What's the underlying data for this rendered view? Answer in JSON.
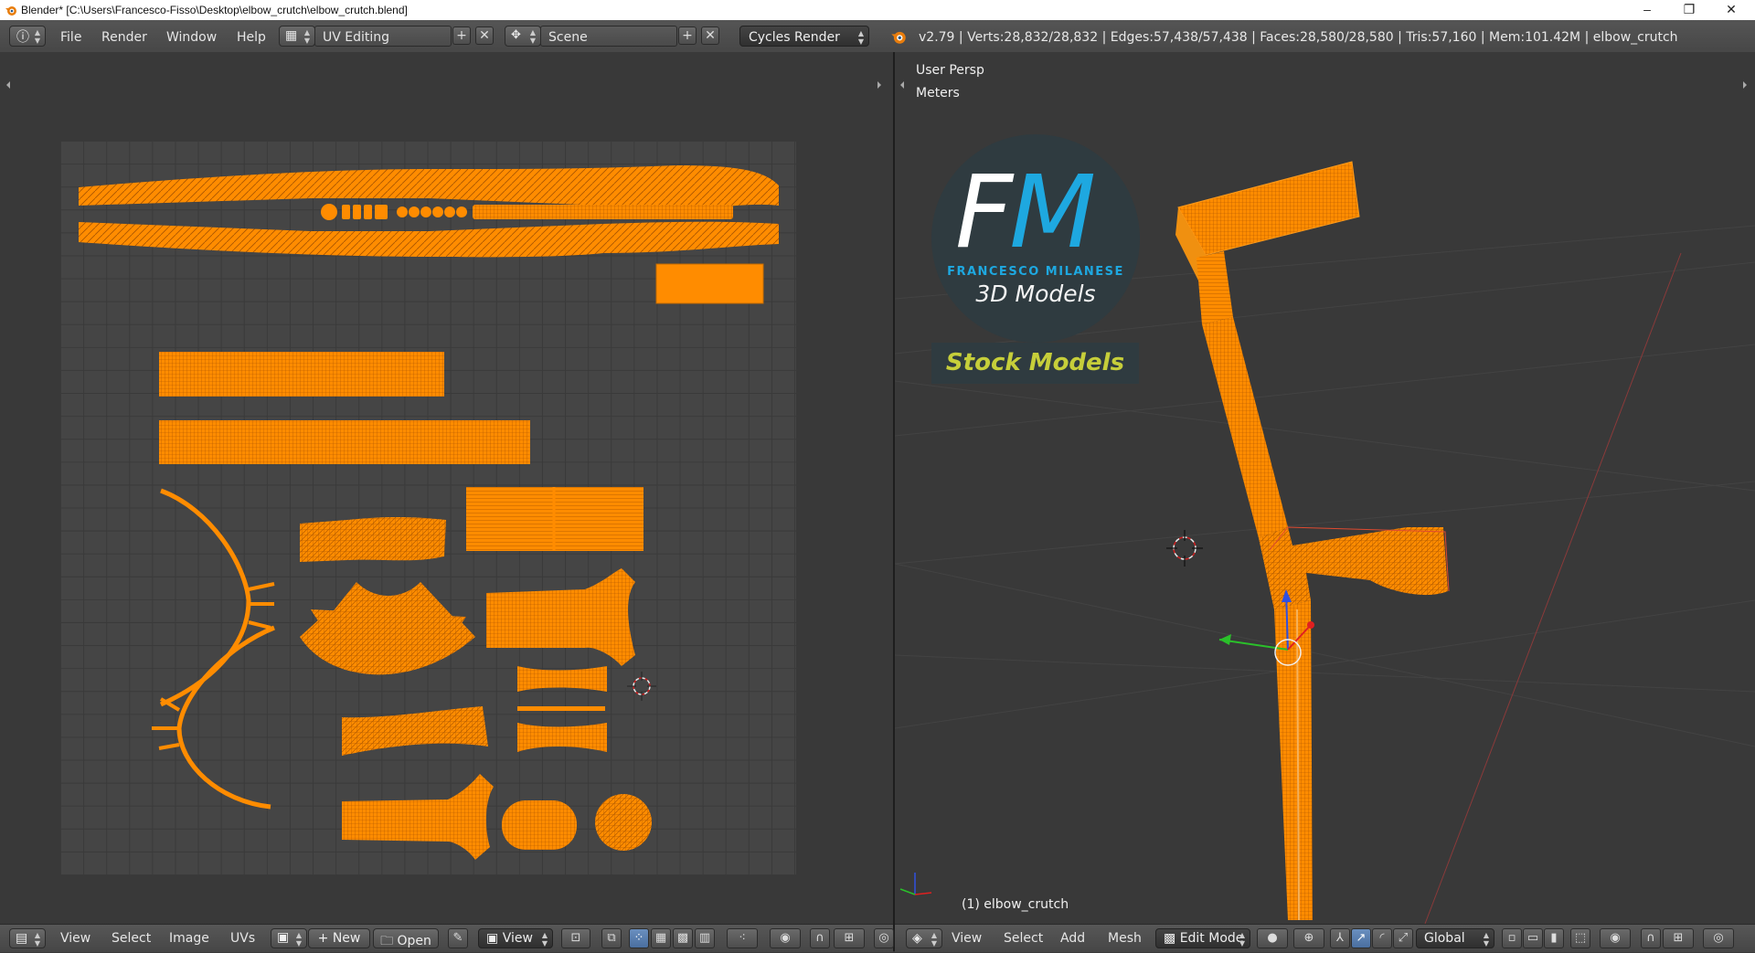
{
  "window": {
    "title": "Blender* [C:\\Users\\Francesco-Fisso\\Desktop\\elbow_crutch\\elbow_crutch.blend]",
    "controls": [
      "–",
      "❐",
      "✕"
    ]
  },
  "info_header": {
    "menus": [
      "File",
      "Render",
      "Window",
      "Help"
    ],
    "screen_layout": "UV Editing",
    "scene": "Scene",
    "render_engine": "Cycles Render",
    "stats": "v2.79 | Verts:28,832/28,832 | Edges:57,438/57,438 | Faces:28,580/28,580 | Tris:57,160 | Mem:101.42M | elbow_crutch"
  },
  "uv_editor": {
    "menus": [
      "View",
      "Select",
      "Image",
      "UVs"
    ],
    "new_label": "New",
    "open_label": "Open",
    "view_label": "View"
  },
  "viewport": {
    "view_name": "User Persp",
    "units": "Meters",
    "object_label": "(1) elbow_crutch",
    "menus": [
      "View",
      "Select",
      "Add",
      "Mesh"
    ],
    "mode": "Edit Mode",
    "orientation": "Global"
  },
  "logo": {
    "f": "F",
    "m": "M",
    "name": "FRANCESCO MILANESE",
    "subtitle": "3D Models",
    "badge": "Stock Models"
  },
  "colors": {
    "uv_orange": "#ff8c00",
    "background": "#393939",
    "grid": "#454545",
    "logo_blue": "#1ea8e0",
    "logo_yellow": "#c6ce3a"
  }
}
